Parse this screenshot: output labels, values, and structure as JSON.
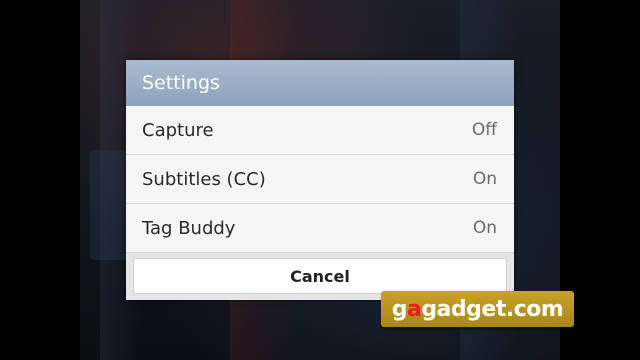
{
  "dialog": {
    "title": "Settings",
    "items": [
      {
        "label": "Capture",
        "value": "Off"
      },
      {
        "label": "Subtitles (CC)",
        "value": "On"
      },
      {
        "label": "Tag Buddy",
        "value": "On"
      }
    ],
    "cancel_label": "Cancel"
  },
  "watermark": {
    "prefix": "g",
    "accent": "a",
    "rest": "gadget.com"
  },
  "colors": {
    "header": "#9fb2c8",
    "dialog_bg": "#f5f5f5",
    "watermark_bg": "#b8951f",
    "watermark_accent": "#e8201a"
  }
}
